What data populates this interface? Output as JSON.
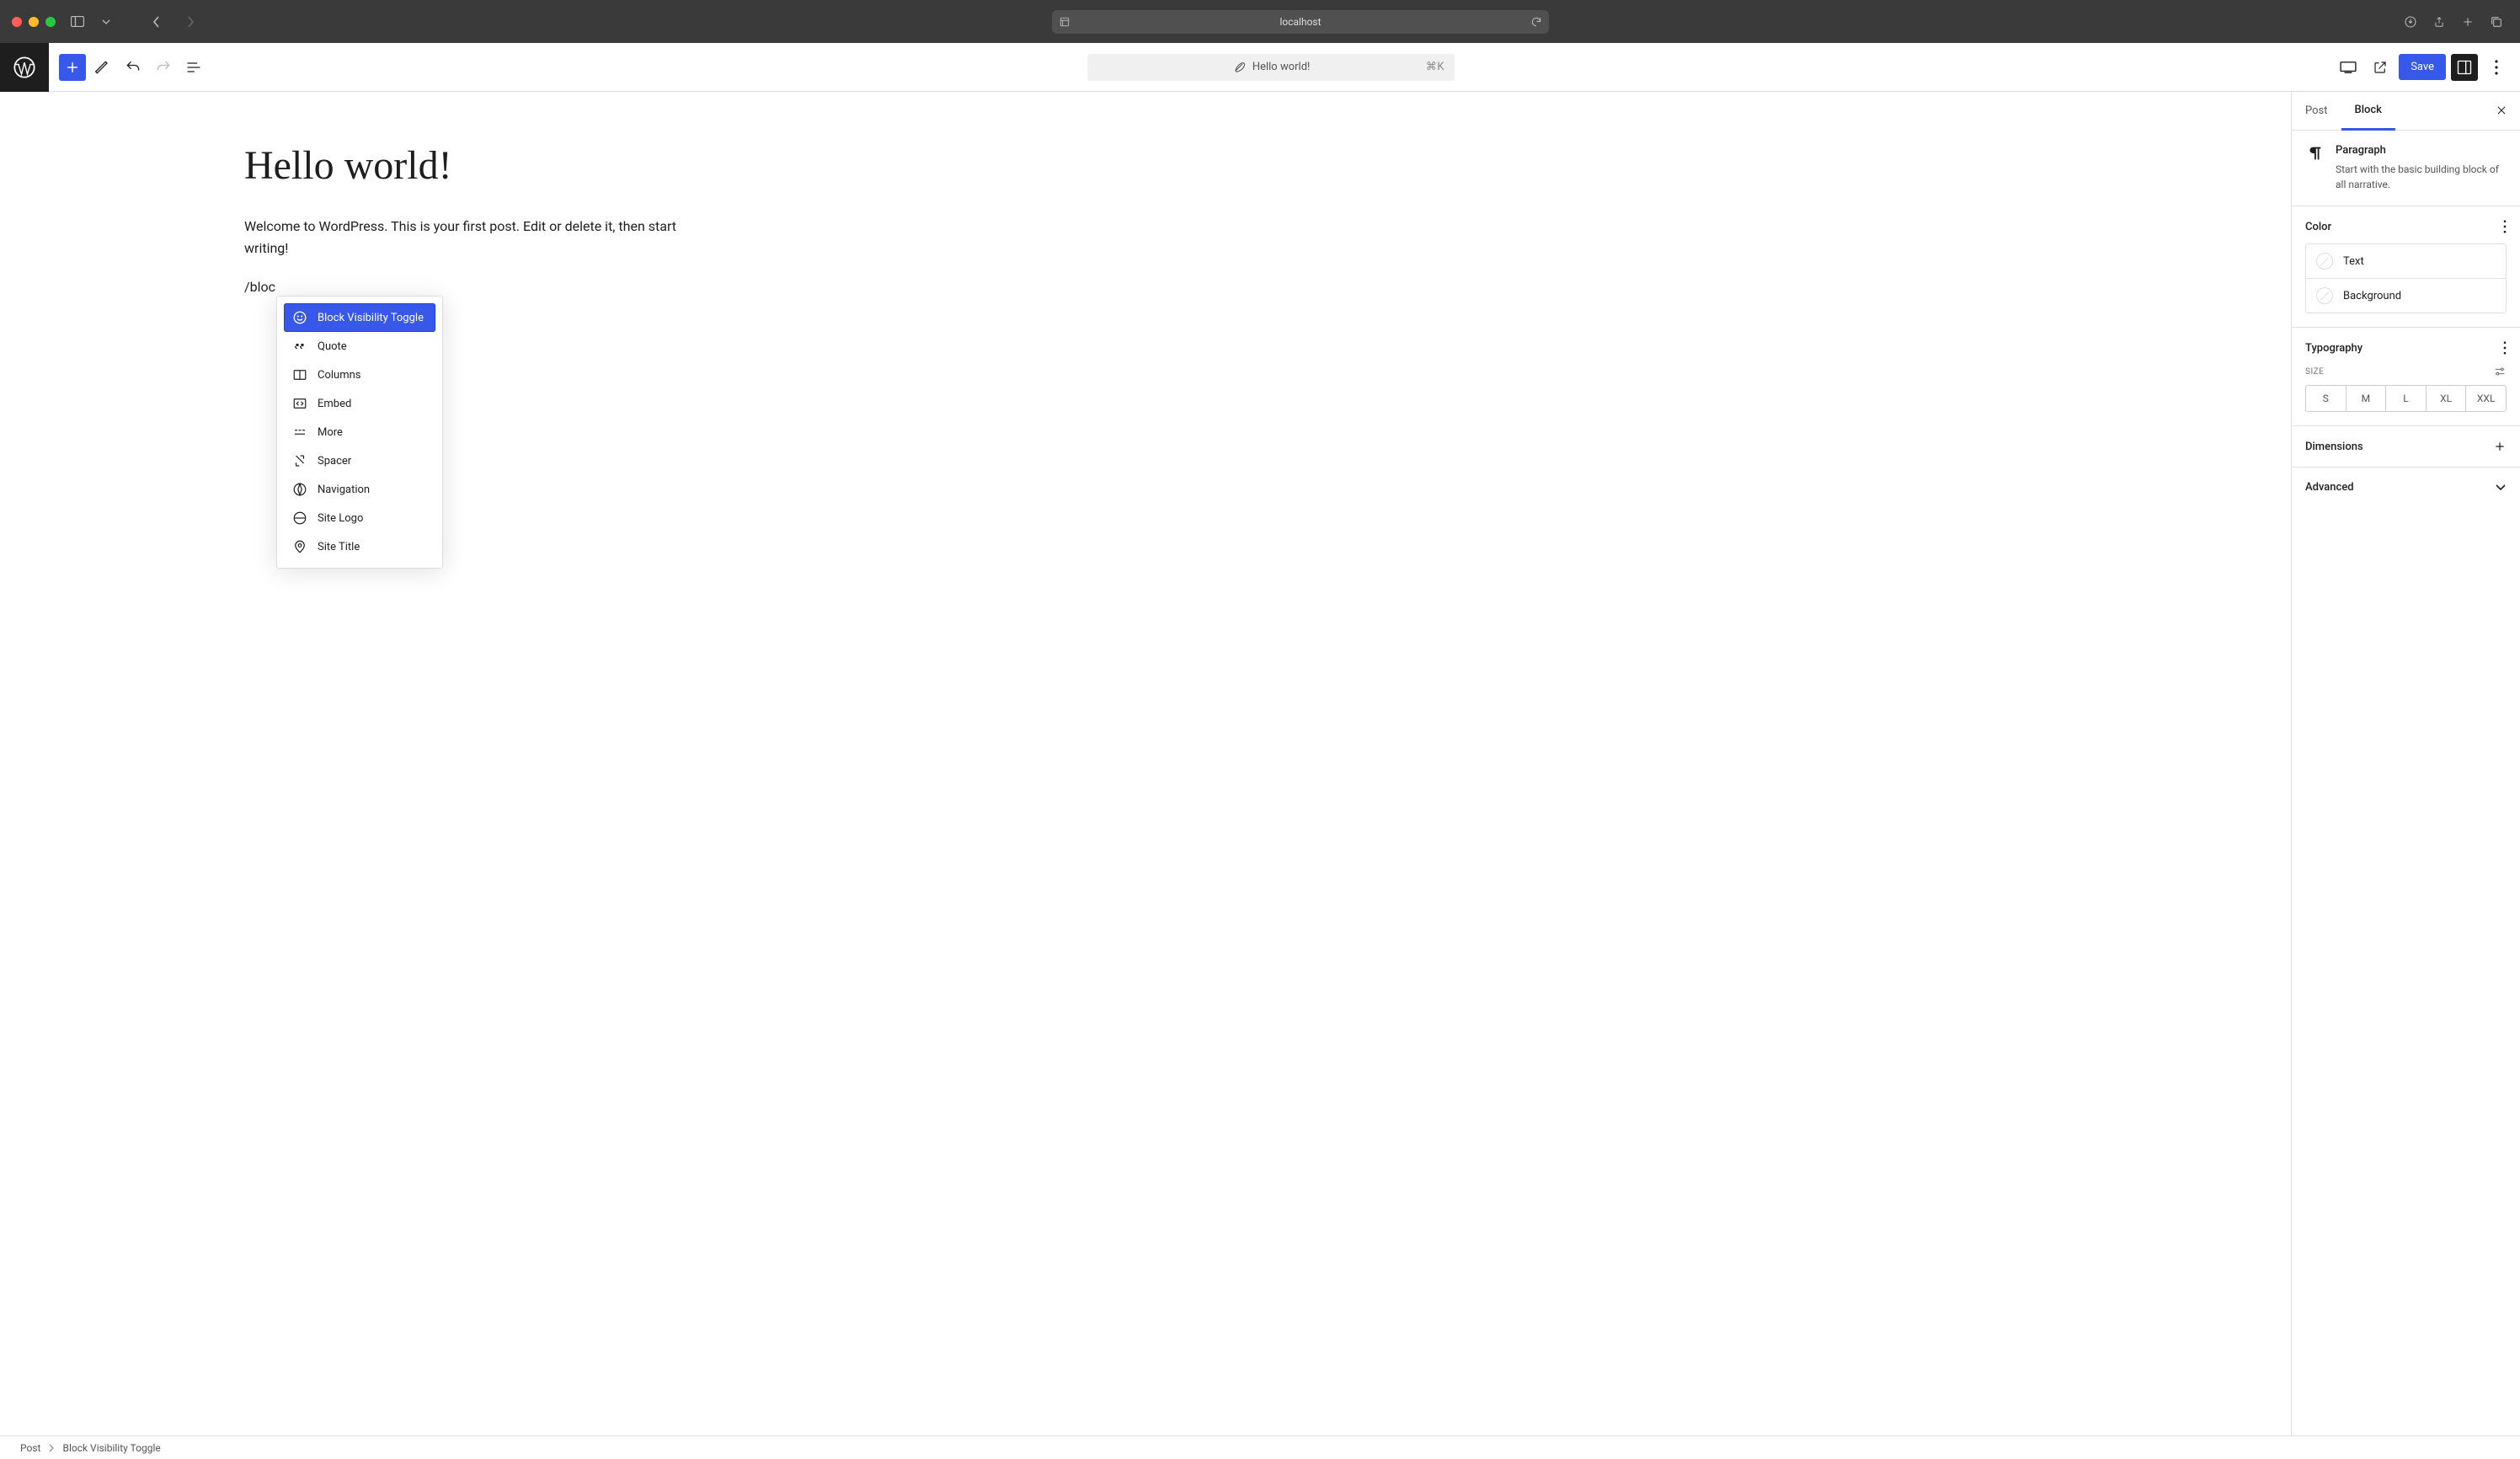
{
  "browser": {
    "url": "localhost"
  },
  "toolbar": {
    "doc_title": "Hello world!",
    "shortcut": "⌘K",
    "save_label": "Save"
  },
  "editor": {
    "title": "Hello world!",
    "paragraph": "Welcome to WordPress. This is your first post. Edit or delete it, then start writing!",
    "slash_text": "/bloc"
  },
  "popover": {
    "items": [
      {
        "label": "Block Visibility Toggle",
        "icon": "smile",
        "selected": true
      },
      {
        "label": "Quote",
        "icon": "quote",
        "selected": false
      },
      {
        "label": "Columns",
        "icon": "columns",
        "selected": false
      },
      {
        "label": "Embed",
        "icon": "embed",
        "selected": false
      },
      {
        "label": "More",
        "icon": "more",
        "selected": false
      },
      {
        "label": "Spacer",
        "icon": "spacer",
        "selected": false
      },
      {
        "label": "Navigation",
        "icon": "navigation",
        "selected": false
      },
      {
        "label": "Site Logo",
        "icon": "sitelogo",
        "selected": false
      },
      {
        "label": "Site Title",
        "icon": "sitetitle",
        "selected": false
      }
    ]
  },
  "sidebar": {
    "tabs": {
      "post": "Post",
      "block": "Block"
    },
    "block_info": {
      "title": "Paragraph",
      "desc": "Start with the basic building block of all narrative."
    },
    "panels": {
      "color": {
        "title": "Color",
        "text_label": "Text",
        "background_label": "Background"
      },
      "typography": {
        "title": "Typography",
        "size_label": "SIZE",
        "sizes": [
          "S",
          "M",
          "L",
          "XL",
          "XXL"
        ]
      },
      "dimensions": {
        "title": "Dimensions"
      },
      "advanced": {
        "title": "Advanced"
      }
    }
  },
  "breadcrumb": {
    "root": "Post",
    "current": "Block Visibility Toggle"
  }
}
